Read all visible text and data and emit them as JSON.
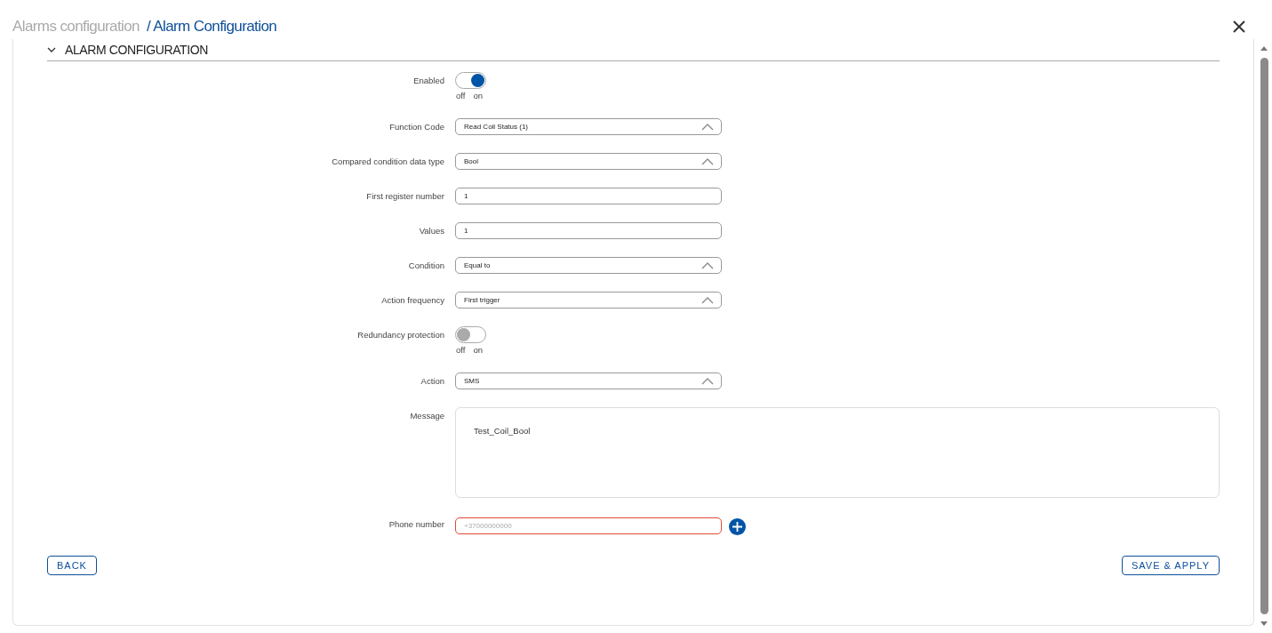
{
  "breadcrumb": {
    "parent": "Alarms configuration",
    "current": "/ Alarm Configuration"
  },
  "section": {
    "title": "ALARM CONFIGURATION",
    "expanded": true
  },
  "fields": [
    {
      "kind": "toggle",
      "label": "Enabled",
      "on": true,
      "off_label": "off",
      "on_label": "on"
    },
    {
      "kind": "select",
      "label": "Function Code",
      "value": "Read Coil Status (1)"
    },
    {
      "kind": "select",
      "label": "Compared condition data type",
      "value": "Bool"
    },
    {
      "kind": "text",
      "label": "First register number",
      "value": "1"
    },
    {
      "kind": "text",
      "label": "Values",
      "value": "1"
    },
    {
      "kind": "select",
      "label": "Condition",
      "value": "Equal to"
    },
    {
      "kind": "select",
      "label": "Action frequency",
      "value": "First trigger"
    },
    {
      "kind": "toggle",
      "label": "Redundancy protection",
      "on": false,
      "off_label": "off",
      "on_label": "on"
    },
    {
      "kind": "select",
      "label": "Action",
      "value": "SMS"
    },
    {
      "kind": "textarea",
      "label": "Message",
      "value": "Test_Coil_Bool"
    },
    {
      "kind": "phone",
      "label": "Phone number",
      "placeholder": "+37000000000",
      "invalid": true
    }
  ],
  "buttons": {
    "back": "BACK",
    "save": "SAVE & APPLY"
  }
}
